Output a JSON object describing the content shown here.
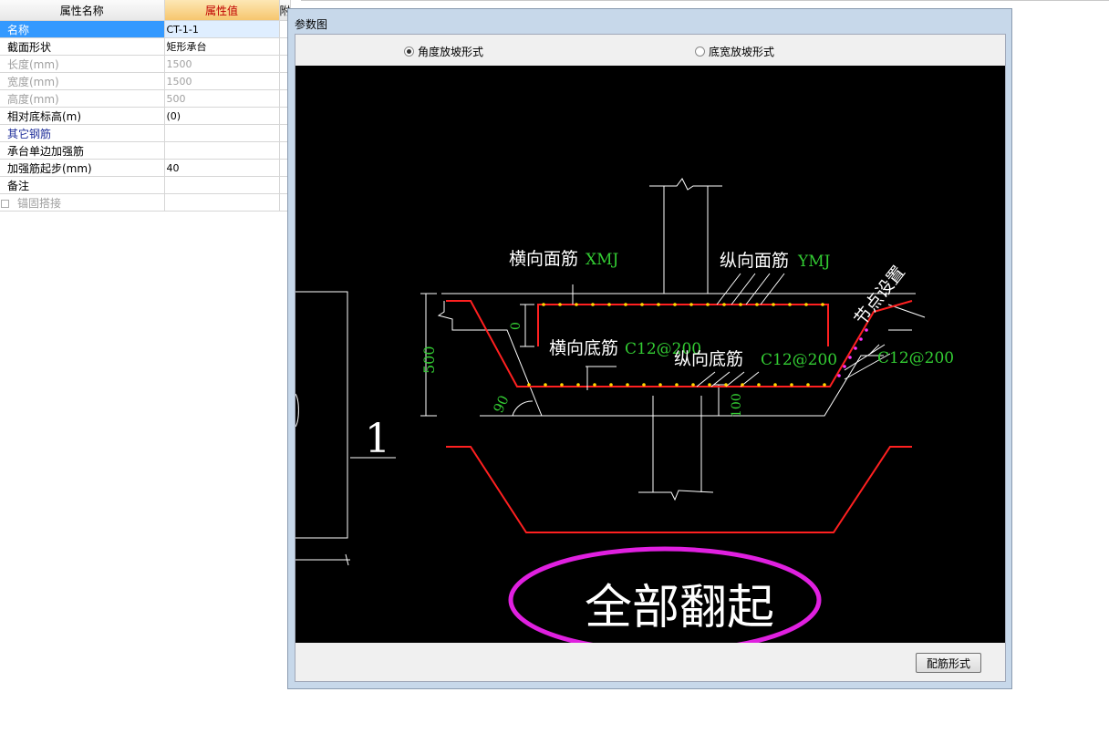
{
  "property_grid": {
    "headers": {
      "name": "属性名称",
      "value": "属性值",
      "attach": "附加"
    },
    "rows": [
      {
        "name": "名称",
        "value": "CT-1-1"
      },
      {
        "name": "截面形状",
        "value": "矩形承台"
      },
      {
        "name": "长度(mm)",
        "value": "1500"
      },
      {
        "name": "宽度(mm)",
        "value": "1500"
      },
      {
        "name": "高度(mm)",
        "value": "500"
      },
      {
        "name": "相对底标高(m)",
        "value": "(0)"
      },
      {
        "name": "其它钢筋",
        "value": ""
      },
      {
        "name": "承台单边加强筋",
        "value": ""
      },
      {
        "name": "加强筋起步(mm)",
        "value": "40"
      },
      {
        "name": "备注",
        "value": ""
      },
      {
        "name": "锚固搭接",
        "value": ""
      }
    ]
  },
  "dialog": {
    "title": "参数图",
    "radio_options": [
      {
        "label": "角度放坡形式",
        "selected": true
      },
      {
        "label": "底宽放坡形式",
        "selected": false
      }
    ],
    "config_button": "配筋形式"
  },
  "drawing": {
    "labels": {
      "transverse_top": "横向面筋",
      "transverse_top_code": "XMJ",
      "longitudinal_top": "纵向面筋",
      "longitudinal_top_code": "YMJ",
      "node_setting": "节点设置",
      "transverse_bottom": "横向底筋",
      "transverse_bottom_value": "C12@200",
      "longitudinal_bottom": "纵向底筋",
      "longitudinal_bottom_value": "C12@200",
      "side_value": "C12@200",
      "dim_height": "500",
      "dim_zero": "0",
      "dim_angle": "90",
      "dim_cover": "100",
      "section_number": "1",
      "callout": "全部翻起"
    },
    "colors": {
      "rebar": "#ff2020",
      "dimension": "#33cc33",
      "outline": "#ffffff",
      "marker": "#ff33ff",
      "dots": "#ffd700",
      "background": "#000000"
    }
  }
}
